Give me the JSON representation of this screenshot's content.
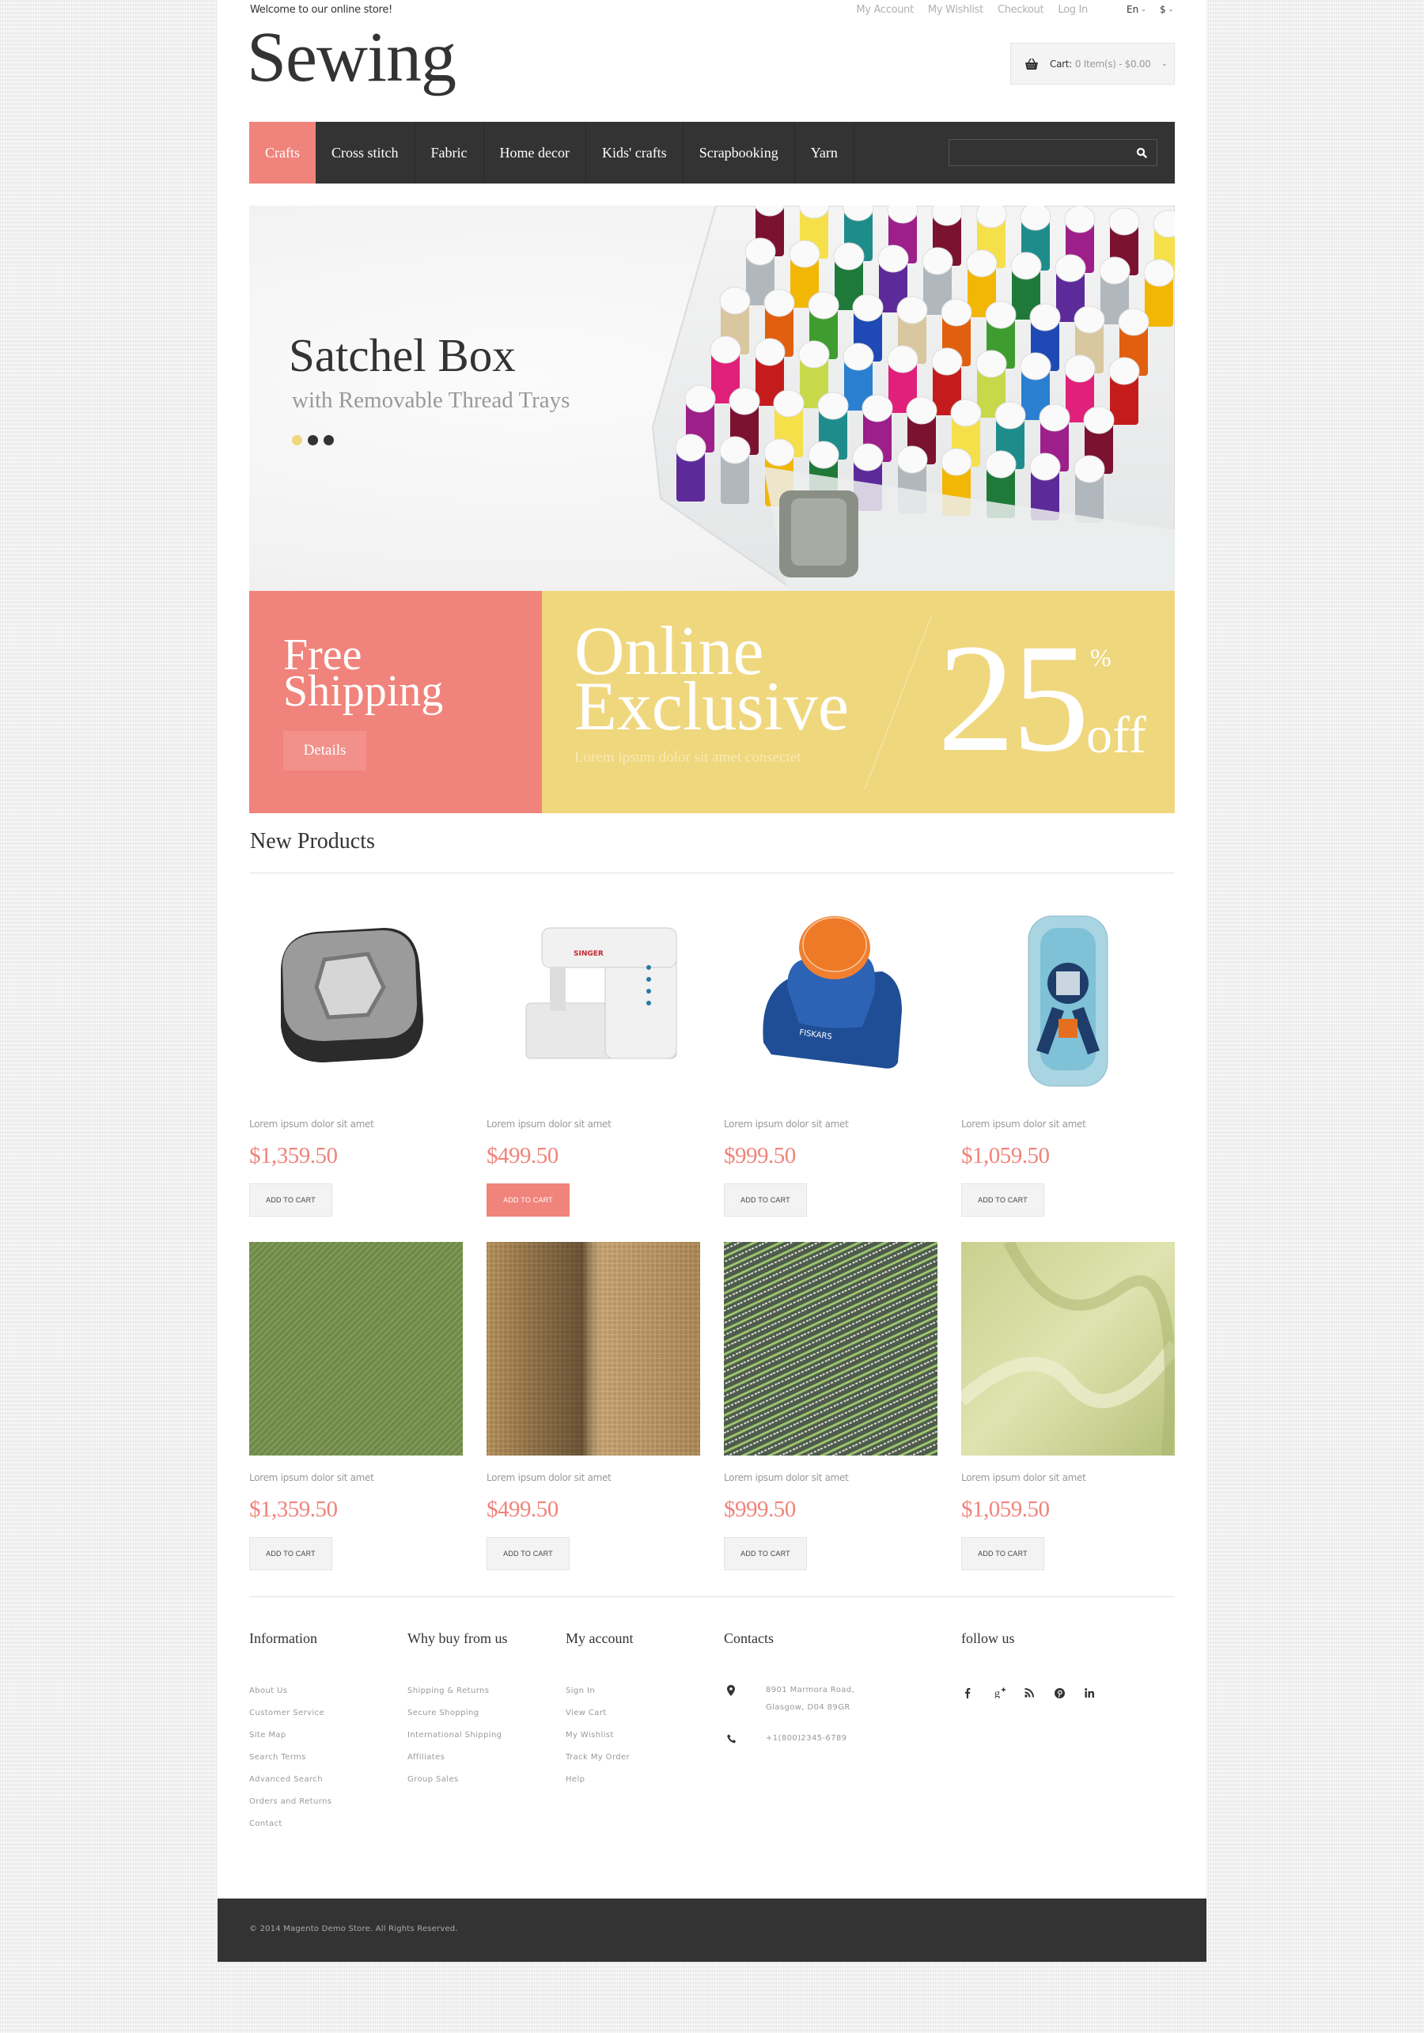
{
  "topbar": {
    "welcome": "Welcome to our online store!",
    "links": [
      "My Account",
      "My Wishlist",
      "Checkout",
      "Log In"
    ],
    "language": "En",
    "currency": "$"
  },
  "header": {
    "logo": "Sewing",
    "cart_label": "Cart:",
    "cart_value": "0 Item(s) - $0.00"
  },
  "nav": {
    "items": [
      {
        "label": "Crafts",
        "active": true
      },
      {
        "label": "Cross stitch"
      },
      {
        "label": "Fabric"
      },
      {
        "label": "Home decor"
      },
      {
        "label": "Kids' crafts"
      },
      {
        "label": "Scrapbooking"
      },
      {
        "label": "Yarn"
      }
    ],
    "search_placeholder": ""
  },
  "hero": {
    "title": "Satchel Box",
    "subtitle": "with Removable Thread Trays",
    "slides": 3,
    "active_slide": 1
  },
  "banners": {
    "shipping": {
      "line1": "Free",
      "line2": "Shipping",
      "button": "Details"
    },
    "exclusive": {
      "line1": "Online",
      "line2": "Exclusive",
      "subtitle": "Lorem ipsum dolor sit amet consectet",
      "discount": "25",
      "percent": "%",
      "off": "off"
    }
  },
  "new_products": {
    "title": "New Products",
    "items": [
      {
        "name": "Lorem ipsum dolor sit amet",
        "price": "$1,359.50",
        "button": "ADD TO CART",
        "image": "bias-tape-maker"
      },
      {
        "name": "Lorem ipsum dolor sit amet",
        "price": "$499.50",
        "button": "ADD TO CART",
        "image": "sewing-machine",
        "highlight": true
      },
      {
        "name": "Lorem ipsum dolor sit amet",
        "price": "$999.50",
        "button": "ADD TO CART",
        "image": "fiskars-punch"
      },
      {
        "name": "Lorem ipsum dolor sit amet",
        "price": "$1,059.50",
        "button": "ADD TO CART",
        "image": "squeeze-punch"
      },
      {
        "name": "Lorem ipsum dolor sit amet",
        "price": "$1,359.50",
        "button": "ADD TO CART",
        "image": "green-mesh-fabric"
      },
      {
        "name": "Lorem ipsum dolor sit amet",
        "price": "$499.50",
        "button": "ADD TO CART",
        "image": "burlap-fabric"
      },
      {
        "name": "Lorem ipsum dolor sit amet",
        "price": "$999.50",
        "button": "ADD TO CART",
        "image": "green-yarn"
      },
      {
        "name": "Lorem ipsum dolor sit amet",
        "price": "$1,059.50",
        "button": "ADD TO CART",
        "image": "chiffon-fabric"
      }
    ]
  },
  "footer": {
    "columns": [
      {
        "title": "Information",
        "links": [
          "About Us",
          "Customer Service",
          "Site Map",
          "Search Terms",
          "Advanced Search",
          "Orders and Returns",
          "Contact"
        ]
      },
      {
        "title": "Why buy from us",
        "links": [
          "Shipping & Returns",
          "Secure Shopping",
          "International Shipping",
          "Affiliates",
          "Group Sales"
        ]
      },
      {
        "title": "My account",
        "links": [
          "Sign In",
          "View Cart",
          "My Wishlist",
          "Track My Order",
          "Help"
        ]
      }
    ],
    "contacts": {
      "title": "Contacts",
      "address_line1": "8901 Marmora Road,",
      "address_line2": "Glasgow, D04 89GR",
      "phone": "+1(800)2345-6789"
    },
    "follow": {
      "title": "follow us",
      "icons": [
        "facebook-icon",
        "google-plus-icon",
        "rss-icon",
        "pinterest-icon",
        "linkedin-icon"
      ]
    },
    "copyright": "© 2014 Magento Demo Store. All Rights Reserved."
  },
  "colors": {
    "accent_pink": "#f0837b",
    "accent_yellow": "#efd77d",
    "dark": "#333333"
  }
}
